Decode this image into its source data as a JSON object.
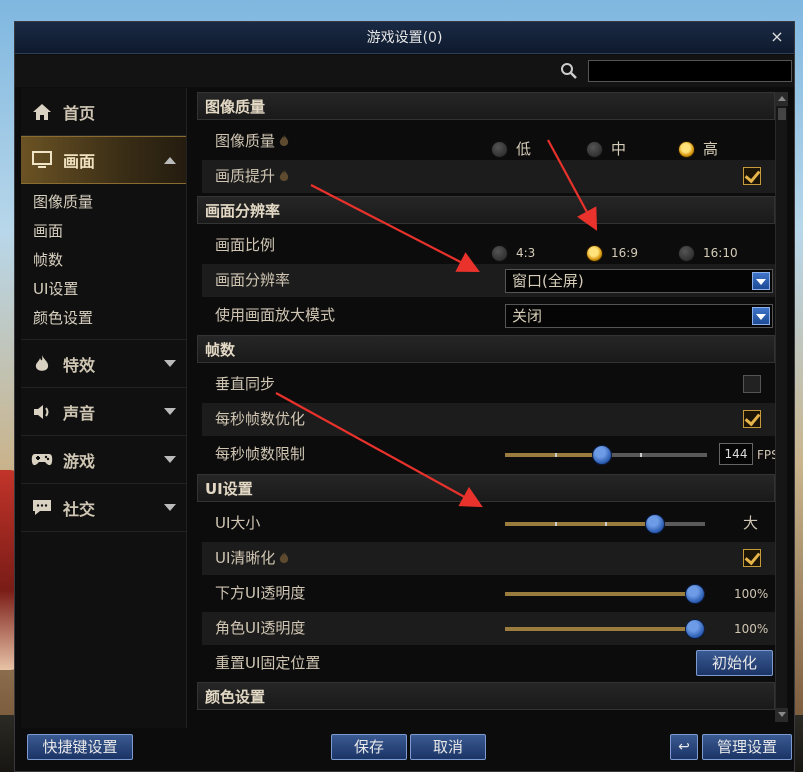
{
  "window": {
    "title": "游戏设置(0)",
    "close_label": "×"
  },
  "search": {
    "value": "",
    "placeholder": ""
  },
  "sidebar": {
    "items": [
      {
        "label": "首页",
        "icon": "home-icon"
      },
      {
        "label": "画面",
        "icon": "monitor-icon"
      },
      {
        "label": "特效",
        "icon": "flame-icon"
      },
      {
        "label": "声音",
        "icon": "speaker-icon"
      },
      {
        "label": "游戏",
        "icon": "gamepad-icon"
      },
      {
        "label": "社交",
        "icon": "chat-icon"
      }
    ],
    "subitems": [
      "图像质量",
      "画面",
      "帧数",
      "UI设置",
      "颜色设置"
    ]
  },
  "sections": {
    "image_quality": "图像质量",
    "resolution": "画面分辨率",
    "framerate": "帧数",
    "ui": "UI设置",
    "color": "颜色设置"
  },
  "rows": {
    "image_quality": {
      "label": "图像质量",
      "options": [
        "低",
        "中",
        "高"
      ],
      "selected": "高"
    },
    "quality_boost": {
      "label": "画质提升",
      "checked": true
    },
    "aspect_ratio": {
      "label": "画面比例",
      "options": [
        "4:3",
        "16:9",
        "16:10"
      ],
      "selected": "16:9"
    },
    "resolution": {
      "label": "画面分辨率",
      "value": "窗口(全屏)"
    },
    "zoom_mode": {
      "label": "使用画面放大模式",
      "value": "关闭"
    },
    "vsync": {
      "label": "垂直同步",
      "checked": false
    },
    "fps_opt": {
      "label": "每秒帧数优化",
      "checked": true
    },
    "fps_limit": {
      "label": "每秒帧数限制",
      "value": "144",
      "unit": "FPS",
      "level": 0.48
    },
    "ui_size": {
      "label": "UI大小",
      "value_text": "大",
      "level": 0.75
    },
    "ui_clarity": {
      "label": "UI清晰化",
      "checked": true
    },
    "bottom_ui_opacity": {
      "label": "下方UI透明度",
      "value": "100%",
      "level": 1.0
    },
    "char_ui_opacity": {
      "label": "角色UI透明度",
      "value": "100%",
      "level": 1.0
    },
    "reset_ui": {
      "label": "重置UI固定位置",
      "button": "初始化"
    }
  },
  "footer": {
    "shortcut": "快捷键设置",
    "save": "保存",
    "cancel": "取消",
    "manage": "管理设置"
  },
  "colors": {
    "accent": "#e0a020",
    "button": "#2a4a85",
    "arrow": "#e8322b"
  }
}
